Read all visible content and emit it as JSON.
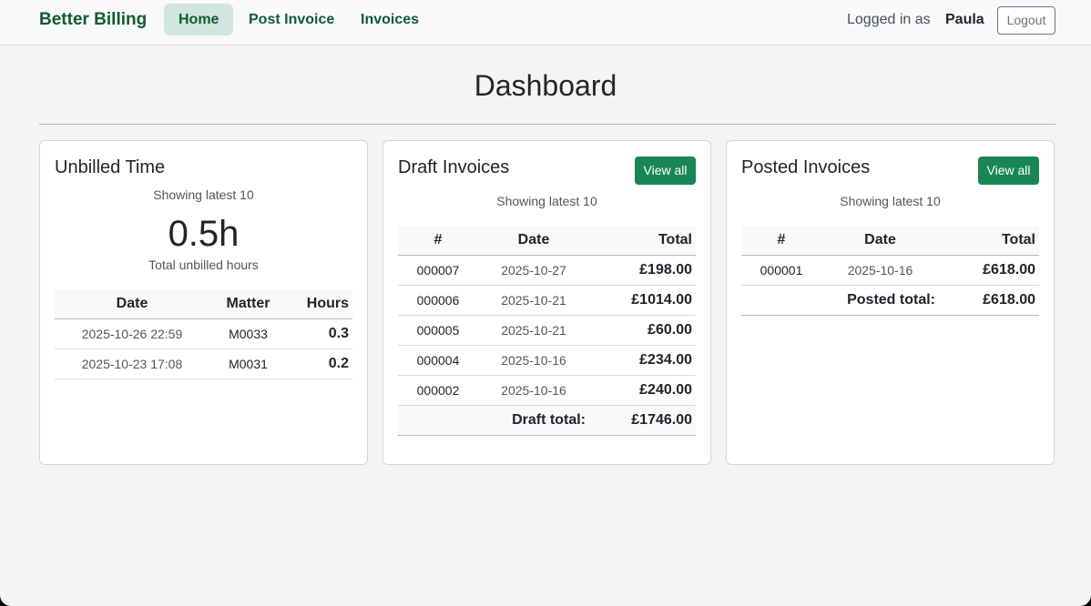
{
  "navbar": {
    "brand": "Better Billing",
    "links": [
      {
        "label": "Home",
        "active": true
      },
      {
        "label": "Post Invoice",
        "active": false
      },
      {
        "label": "Invoices",
        "active": false
      }
    ],
    "logged_in_label": "Logged in as",
    "user": "Paula",
    "logout_label": "Logout"
  },
  "page_title": "Dashboard",
  "unbilled": {
    "title": "Unbilled Time",
    "subtitle": "Showing latest 10",
    "total": "0.5h",
    "total_label": "Total unbilled hours",
    "headers": [
      "Date",
      "Matter",
      "Hours"
    ],
    "rows": [
      {
        "date": "2025-10-26 22:59",
        "matter": "M0033",
        "hours": "0.3"
      },
      {
        "date": "2025-10-23 17:08",
        "matter": "M0031",
        "hours": "0.2"
      }
    ]
  },
  "draft": {
    "title": "Draft Invoices",
    "view_all_label": "View all",
    "subtitle": "Showing latest 10",
    "headers": [
      "#",
      "Date",
      "Total"
    ],
    "rows": [
      {
        "num": "000007",
        "date": "2025-10-27",
        "total": "£198.00"
      },
      {
        "num": "000006",
        "date": "2025-10-21",
        "total": "£1014.00"
      },
      {
        "num": "000005",
        "date": "2025-10-21",
        "total": "£60.00"
      },
      {
        "num": "000004",
        "date": "2025-10-16",
        "total": "£234.00"
      },
      {
        "num": "000002",
        "date": "2025-10-16",
        "total": "£240.00"
      }
    ],
    "total_label": "Draft total:",
    "total_value": "£1746.00"
  },
  "posted": {
    "title": "Posted Invoices",
    "view_all_label": "View all",
    "subtitle": "Showing latest 10",
    "headers": [
      "#",
      "Date",
      "Total"
    ],
    "rows": [
      {
        "num": "000001",
        "date": "2025-10-16",
        "total": "£618.00"
      }
    ],
    "total_label": "Posted total:",
    "total_value": "£618.00"
  },
  "colors": {
    "brand": "#145a32",
    "button": "#198754",
    "active_nav_bg": "#d1e7dd"
  }
}
